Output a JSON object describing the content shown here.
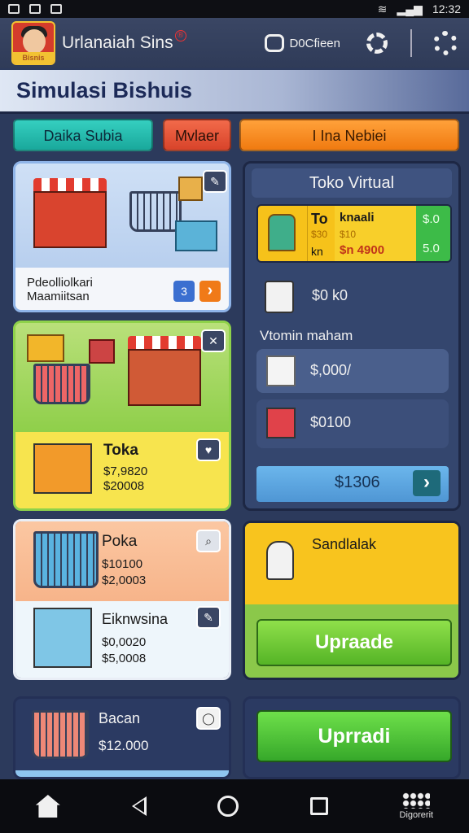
{
  "status_bar": {
    "time": "12:32"
  },
  "app_bar": {
    "title": "Urlanaiah Sins",
    "badge": "®",
    "avatar_tag": "Bisnis",
    "action_label": "D0Cfieen"
  },
  "page": {
    "title": "Simulasi Bishuis"
  },
  "tabs": [
    {
      "label": "Daika Subia"
    },
    {
      "label": "Mvlaer"
    },
    {
      "label": "I Ina Nebiei"
    }
  ],
  "card1": {
    "caption1": "Pdeolliolkari",
    "caption2": "Maamiitsan",
    "btn_a": "3",
    "btn_b": "›"
  },
  "card2": {
    "title": "Toka",
    "line1": "$7,9820",
    "line2": "$20008"
  },
  "card3": {
    "title": "Poka",
    "line1": "$10100",
    "line2": "$2,0003"
  },
  "card4": {
    "title": "Eiknwsina",
    "line1": "$0,0020",
    "line2": "$5,0008"
  },
  "card5": {
    "title": "Bacan",
    "value": "$12.000"
  },
  "right_panel": {
    "title": "Toko Virtual",
    "feature": {
      "title": "To",
      "sub1": "knaali",
      "sub2": "$30",
      "sub3": "$10",
      "code1": "kn",
      "price": "$n 4900",
      "green_top": "$.0",
      "green_bottom": "5.0"
    },
    "item1_value": "$0 k0",
    "section_label": "Vtomin maham",
    "item2_value": "$,000/",
    "item3_value": "$0100",
    "action_label": "$1306",
    "action_arrow": "›"
  },
  "upgrade_card": {
    "title": "Sandlalak",
    "button": "Upraade"
  },
  "bottom_card": {
    "button": "Uprradi"
  },
  "nav": {
    "grid_label": "Digorerit"
  },
  "colors": {
    "accent_green": "#5cc23a",
    "accent_orange": "#f08a18",
    "accent_yellow": "#f6c21a",
    "accent_teal": "#22b8aa"
  }
}
